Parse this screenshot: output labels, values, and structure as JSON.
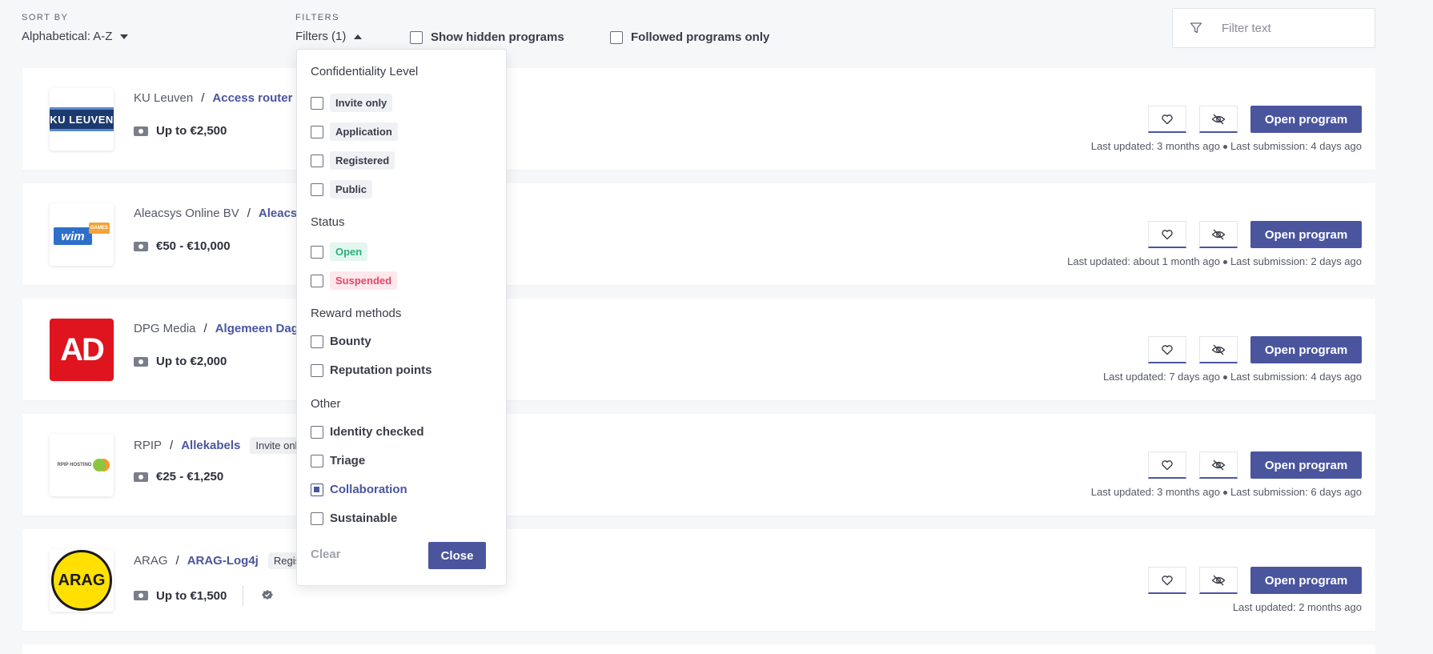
{
  "sort": {
    "label": "SORT BY",
    "value": "Alphabetical: A-Z"
  },
  "filters": {
    "label": "FILTERS",
    "value": "Filters (1)"
  },
  "toggles": {
    "show_hidden": "Show hidden programs",
    "followed_only": "Followed programs only"
  },
  "search": {
    "placeholder": "Filter text"
  },
  "colors": {
    "accent": "#4a559e",
    "open": "#2fae7b",
    "suspended": "#e0486a"
  },
  "programs": [
    {
      "company": "KU Leuven",
      "name": "Access router",
      "badge": "",
      "reward": "Up to €2,500",
      "last_updated": "Last updated: 3 months ago",
      "last_submission": "Last submission: 4 days ago",
      "logo_text": "KU LEUVEN"
    },
    {
      "company": "Aleacsys Online BV",
      "name": "Aleacsy",
      "badge": "",
      "reward": "€50 - €10,000",
      "last_updated": "Last updated: about 1 month ago",
      "last_submission": "Last submission: 2 days ago",
      "logo_text": "wim",
      "logo_tag": "GAMES"
    },
    {
      "company": "DPG Media",
      "name": "Algemeen Dag",
      "badge": "",
      "reward": "Up to €2,000",
      "last_updated": "Last updated: 7 days ago",
      "last_submission": "Last submission: 4 days ago",
      "logo_text": "AD"
    },
    {
      "company": "RPIP",
      "name": "Allekabels",
      "badge": "Invite only",
      "reward": "€25 - €1,250",
      "last_updated": "Last updated: 3 months ago",
      "last_submission": "Last submission: 6 days ago",
      "logo_text": "RPIP HOSTING"
    },
    {
      "company": "ARAG",
      "name": "ARAG-Log4j",
      "badge": "Registe",
      "reward": "Up to €1,500",
      "last_updated": "Last updated: 2 months ago",
      "last_submission": "",
      "logo_text": "ARAG"
    }
  ],
  "open_button": "Open program",
  "panel": {
    "confidentiality": {
      "heading": "Confidentiality Level",
      "options": [
        "Invite only",
        "Application",
        "Registered",
        "Public"
      ]
    },
    "status": {
      "heading": "Status",
      "options": [
        "Open",
        "Suspended"
      ]
    },
    "reward": {
      "heading": "Reward methods",
      "options": [
        "Bounty",
        "Reputation points"
      ]
    },
    "other": {
      "heading": "Other",
      "options": [
        "Identity checked",
        "Triage",
        "Collaboration",
        "Sustainable"
      ],
      "checked": "Collaboration"
    },
    "clear": "Clear",
    "close": "Close"
  }
}
